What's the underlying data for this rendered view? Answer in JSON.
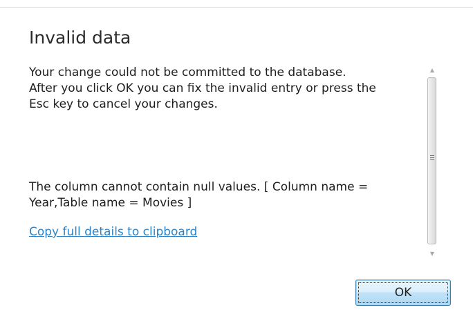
{
  "dialog": {
    "title": "Invalid data",
    "message_lines": [
      "Your change could not be committed to the database.",
      "After you click OK you can fix the invalid entry or press the",
      "Esc key to cancel your changes."
    ],
    "detail_lines": [
      "The column cannot contain null values. [ Column name =",
      "Year,Table name = Movies ]"
    ],
    "details_link": "Copy full details to clipboard",
    "ok_label": "OK"
  },
  "scrollbar": {
    "up_icon": "chevron-up-icon",
    "down_icon": "chevron-down-icon",
    "grip_icon": "grip-icon"
  },
  "colors": {
    "link": "#2b84c9",
    "button_border": "#3c7fb1",
    "title_text": "#2b2b2b"
  }
}
